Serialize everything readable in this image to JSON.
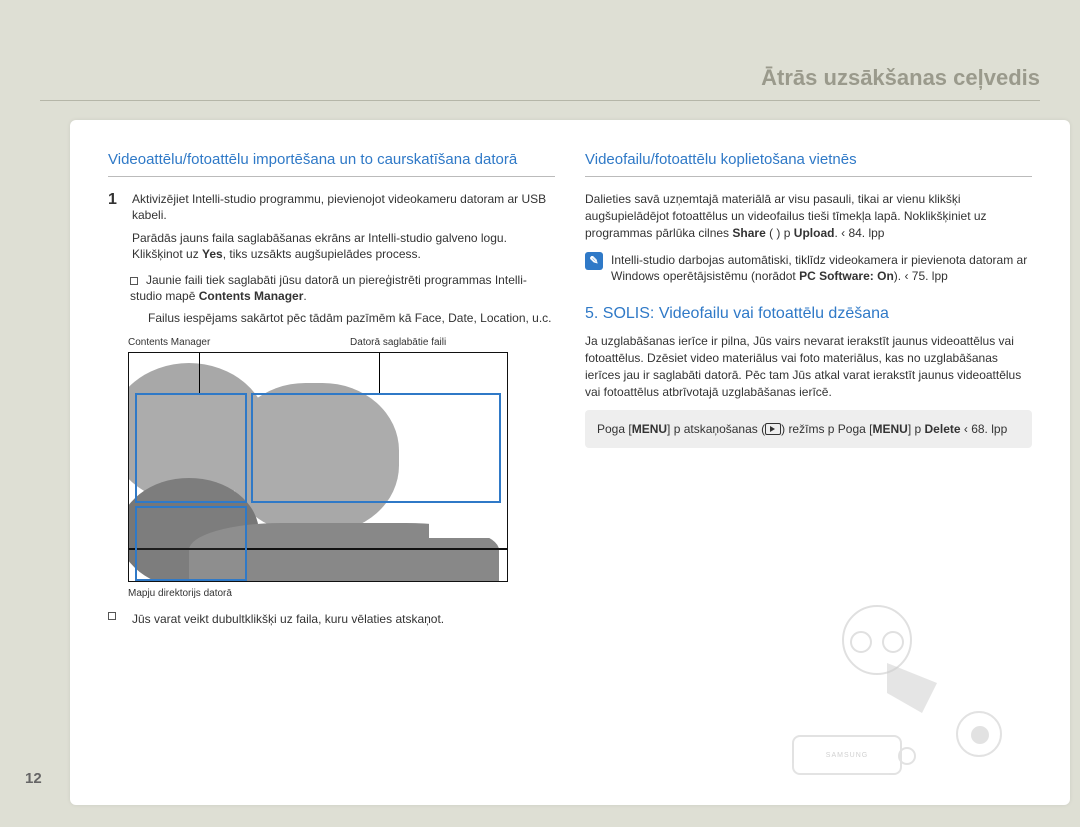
{
  "header": "Ātrās uzsākšanas ceļvedis",
  "page_number": "12",
  "left": {
    "title": "Videoattēlu/fotoattēlu importēšana un to caurskatīšana datorā",
    "step1_num": "1",
    "step1_text": "Aktivizējiet Intelli-studio programmu, pievienojot videokameru datoram ar USB kabeli.",
    "step1_sub": "Parādās jauns faila saglabāšanas ekrāns ar Intelli-studio galveno logu. Klikšķinot uz ",
    "step1_yes": "Yes",
    "step1_sub2": ", tiks uzsākts augšupielādes process.",
    "bullet1a": "Jaunie faili tiek saglabāti jūsu datorā un piereģistrēti programmas Intelli-studio mapē ",
    "bullet1a_b": "Contents Manager",
    "bullet1a_end": ".",
    "bullet1b": "Failus iespējams sakārtot pēc tādām pazīmēm kā Face, Date, Location, u.c.",
    "shot_label_left": "Contents Manager",
    "shot_label_right": "Datorā saglabātie faili",
    "under_label": "Mapju direktorijs datorā",
    "footnote": "Jūs varat veikt dubultklikšķi uz faila, kuru vēlaties atskaņot."
  },
  "right": {
    "title": "Videofailu/fotoattēlu koplietošana vietnēs",
    "para1": "Dalieties savā uzņemtajā materiālā ar visu pasauli, tikai ar vienu klikšķi augšupielādējot fotoattēlus un videofailus tieši tīmekļa lapā. Noklikšķiniet uz programmas pārlūka cilnes ",
    "para1_b1": "Share",
    "para1_mid": " (        ) p ",
    "para1_b2": "Upload",
    "para1_end": ".  ‹ 84. lpp",
    "info_text": "Intelli-studio darbojas automātiski, tiklīdz videokamera ir pievienota datoram ar Windows operētājsistēmu (norādot ",
    "info_b": "PC Software: On",
    "info_end": ").  ‹ 75. lpp",
    "step5_title": "5. SOLIS: Videofailu vai fotoattēlu dzēšana",
    "step5_para": "Ja uzglabāšanas ierīce ir pilna, Jūs vairs nevarat ierakstīt jaunus videoattēlus vai fotoattēlus. Dzēsiet video materiālus vai foto materiālus, kas no uzglabāšanas ierīces jau ir saglabāti datorā. Pēc tam Jūs atkal varat ierakstīt jaunus videoattēlus vai fotoattēlus atbrīvotajā uzglabāšanas ierīcē.",
    "nav_1": "Poga [",
    "nav_menu": "MENU",
    "nav_2": "]  p atskaņošanas (",
    "nav_3": ") režīms  p Poga [",
    "nav_4": "]  p ",
    "nav_delete": "Delete",
    "nav_5": "  ‹ 68. lpp",
    "cam_brand": "SAMSUNG"
  }
}
